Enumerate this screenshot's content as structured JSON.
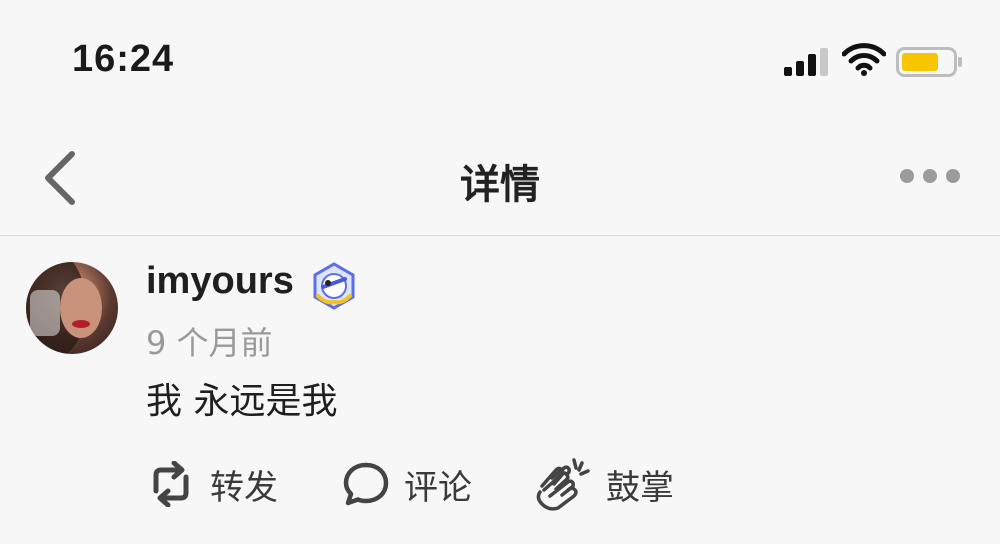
{
  "status_bar": {
    "time": "16:24",
    "icons": [
      "signal-icon",
      "wifi-icon",
      "battery-icon"
    ],
    "battery_color": "#f7c600"
  },
  "nav": {
    "title": "详情",
    "back_icon": "chevron-left-icon",
    "more_icon": "more-dots-icon"
  },
  "post": {
    "username": "imyours",
    "badge_icon": "verified-badge-icon",
    "time": "9 个月前",
    "content": "我 永远是我",
    "actions": {
      "repost": {
        "label": "转发",
        "icon": "repost-icon"
      },
      "comment": {
        "label": "评论",
        "icon": "comment-icon"
      },
      "clap": {
        "label": "鼓掌",
        "icon": "clap-icon"
      }
    }
  }
}
